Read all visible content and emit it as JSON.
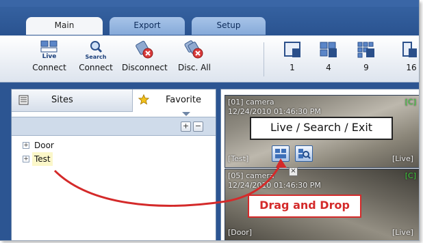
{
  "tabs": [
    {
      "label": "Main"
    },
    {
      "label": "Export"
    },
    {
      "label": "Setup"
    }
  ],
  "toolbar": {
    "live_connect": {
      "icon_text": "Live",
      "label": "Connect"
    },
    "search_connect": {
      "icon_text": "Search",
      "label": "Connect"
    },
    "disconnect": {
      "label": "Disconnect"
    },
    "disconnect_all": {
      "label": "Disc. All"
    },
    "layouts": [
      {
        "label": "1"
      },
      {
        "label": "4"
      },
      {
        "label": "9"
      },
      {
        "label": "16"
      }
    ]
  },
  "panel": {
    "sites_tab": "Sites",
    "favorite_tab": "Favorite",
    "add_symbol": "+",
    "remove_symbol": "−",
    "tree": [
      {
        "label": "Door"
      },
      {
        "label": "Test"
      }
    ]
  },
  "cameras": [
    {
      "title": "[01] camera",
      "datetime": "12/24/2010 01:46:30 PM",
      "status": "[C]",
      "site": "[Test]",
      "mode": "[Live]"
    },
    {
      "title": "[05] camera",
      "datetime": "12/24/2010 01:46:30 PM",
      "status": "[C]",
      "site": "[Door]",
      "mode": "[Live]"
    }
  ],
  "annotations": {
    "callout": "Live / Search / Exit",
    "drag_drop": "Drag and Drop",
    "close_symbol": "×"
  },
  "colors": {
    "accent_blue": "#2c5592",
    "drag_red": "#d42a2a",
    "status_green": "#3fd43f"
  }
}
